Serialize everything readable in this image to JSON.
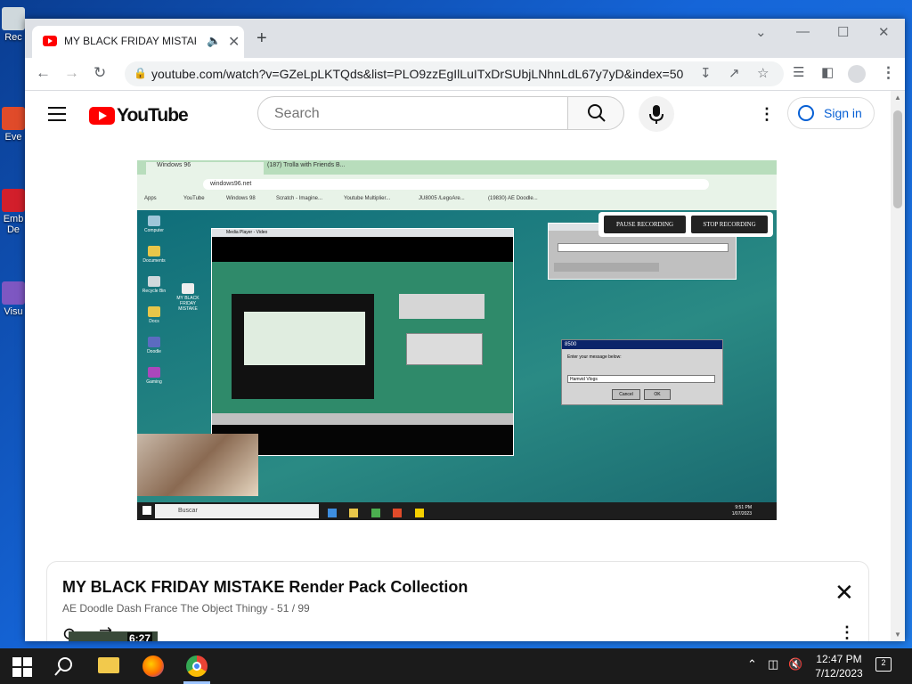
{
  "desktop": {
    "icons": [
      {
        "label": "Rec",
        "name": "recycle-bin"
      },
      {
        "label": "Eve",
        "name": "everything"
      },
      {
        "label": "Emb De",
        "name": "embarcadero-dev"
      },
      {
        "label": "Visu",
        "name": "visual-studio"
      }
    ]
  },
  "browser": {
    "tab_title": "MY BLACK FRIDAY MISTAKE",
    "url": "youtube.com/watch?v=GZeLpLKTQds&list=PLO9zzEgIlLuITxDrSUbjLNhnLdL67y7yD&index=50"
  },
  "youtube": {
    "logo_text": "YouTube",
    "search_placeholder": "Search",
    "signin_label": "Sign in"
  },
  "video_frame": {
    "tab1": "Windows 96",
    "tab2": "(187) Trolla with Friends B...",
    "address": "windows96.net",
    "bookmarks": [
      "Apps",
      "YouTube",
      "Windows 98",
      "Scratch - Imagine...",
      "Youtube Multiplier...",
      "JU8005 /LegoAre...",
      "(19830) AE Doodle..."
    ],
    "pause_label": "PAUSE RECORDING",
    "stop_label": "STOP RECORDING",
    "dialog_title": "8500",
    "dialog_message": "Enter your message below:",
    "dialog_input": "Hamvid Vlogs",
    "dialog_cancel": "Cancel",
    "dialog_ok": "OK",
    "taskbar_search": "Buscar",
    "clock_time": "9:51 PM",
    "clock_date": "1/07/2023",
    "desktop_icons": [
      "Computer",
      "Documents",
      "Recycle Bin",
      "Docs",
      "Doodle",
      "Gaming"
    ],
    "file_label": "MY BLACK FRIDAY MISTAKE",
    "player_title": "Media Player - Video"
  },
  "playlist": {
    "title": "MY BLACK FRIDAY MISTAKE Render Pack Collection",
    "channel": "AE Doodle Dash France The Object Thingy",
    "position": "51 / 99",
    "first_duration": "6:27"
  },
  "taskbar": {
    "time": "12:47 PM",
    "date": "7/12/2023",
    "notifications": "2"
  }
}
